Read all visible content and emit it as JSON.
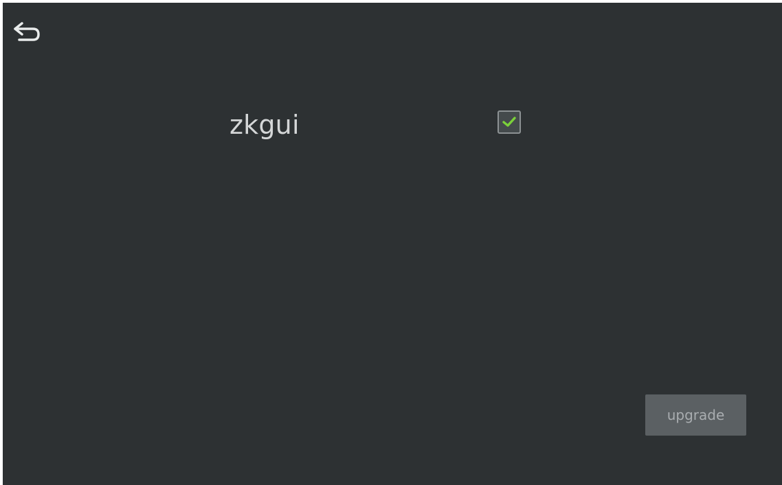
{
  "screen": {
    "background_color": "#2d3133",
    "back_icon": "back-arrow-icon"
  },
  "list": {
    "items": [
      {
        "label": "zkgui",
        "checked": true,
        "check_color": "#7bd13a"
      }
    ]
  },
  "actions": {
    "upgrade_label": "upgrade"
  }
}
